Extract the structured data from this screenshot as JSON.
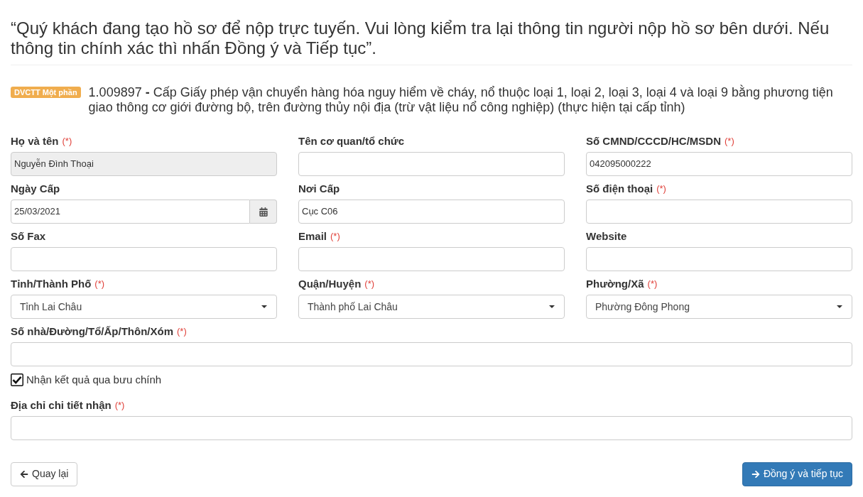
{
  "heading": "“Quý khách đang tạo hồ sơ để nộp trực tuyến. Vui lòng kiểm tra lại thông tin người nộp hồ sơ bên dưới. Nếu thông tin chính xác thì nhấn Đồng ý và Tiếp tục”.",
  "procedure": {
    "badge": "DVCTT Một phần",
    "title": "1.009897 **-** Cấp Giấy phép vận chuyển hàng hóa nguy hiểm về cháy, nổ thuộc loại 1, loại 2, loại 3, loại 4 và loại 9 bằng phương tiện giao thông cơ giới đường bộ, trên đường thủy nội địa (trừ vật liệu nổ công nghiệp) (thực hiện tại cấp tỉnh)"
  },
  "form": {
    "rows": [
      {
        "kind": "fields",
        "fields": [
          {
            "kind": "text",
            "label": "Họ và tên",
            "marker": "(*)",
            "value": "Nguyễn Đình Thoại",
            "disabled": true
          },
          {
            "kind": "text",
            "label": "Tên cơ quan/tổ chức",
            "disabled": false
          },
          {
            "kind": "text",
            "label": "Số CMND/CCCD/HC/MSDN",
            "marker": "(*)",
            "value": "042095000222",
            "disabled": false
          }
        ]
      },
      {
        "kind": "fields",
        "fields": [
          {
            "kind": "date",
            "label": "Ngày Cấp",
            "value": "25/03/2021",
            "disabled": false
          },
          {
            "kind": "text",
            "label": "Nơi Cấp",
            "value": "Cục C06",
            "disabled": false
          },
          {
            "kind": "text",
            "label": "Số điện thoại",
            "marker": "(*)",
            "disabled": false
          }
        ]
      },
      {
        "kind": "fields",
        "fields": [
          {
            "kind": "text",
            "label": "Số Fax",
            "disabled": false
          },
          {
            "kind": "text",
            "label": "Email",
            "marker": "(*)",
            "disabled": false
          },
          {
            "kind": "text",
            "label": "Website",
            "disabled": false
          }
        ]
      },
      {
        "kind": "fields",
        "fields": [
          {
            "kind": "select",
            "label": "Tỉnh/Thành Phố",
            "marker": "(*)",
            "value": "Tỉnh Lai Châu",
            "disabled": false
          },
          {
            "kind": "select",
            "label": "Quận/Huyện",
            "marker": "(*)",
            "value": "Thành phố Lai Châu",
            "disabled": false
          },
          {
            "kind": "select",
            "label": "Phường/Xã",
            "marker": "(*)",
            "value": "Phường Đông Phong",
            "disabled": false
          }
        ]
      },
      {
        "kind": "fields",
        "fields": [
          {
            "kind": "text",
            "label": "Số nhà/Đường/Tổ/Ấp/Thôn/Xóm",
            "marker": "(*)",
            "disabled": false
          }
        ]
      },
      {
        "kind": "checkbox",
        "label": "Nhận kết quả qua bưu chính",
        "checked": true
      },
      {
        "kind": "fields",
        "fields": [
          {
            "kind": "text",
            "label": "Địa chỉ chi tiết nhận",
            "marker": "(*)",
            "disabled": false
          }
        ]
      }
    ]
  },
  "buttons": [
    {
      "kind": "back",
      "label": "Quay lại"
    },
    {
      "kind": "continue",
      "label": "Đồng ý và tiếp tục"
    }
  ]
}
